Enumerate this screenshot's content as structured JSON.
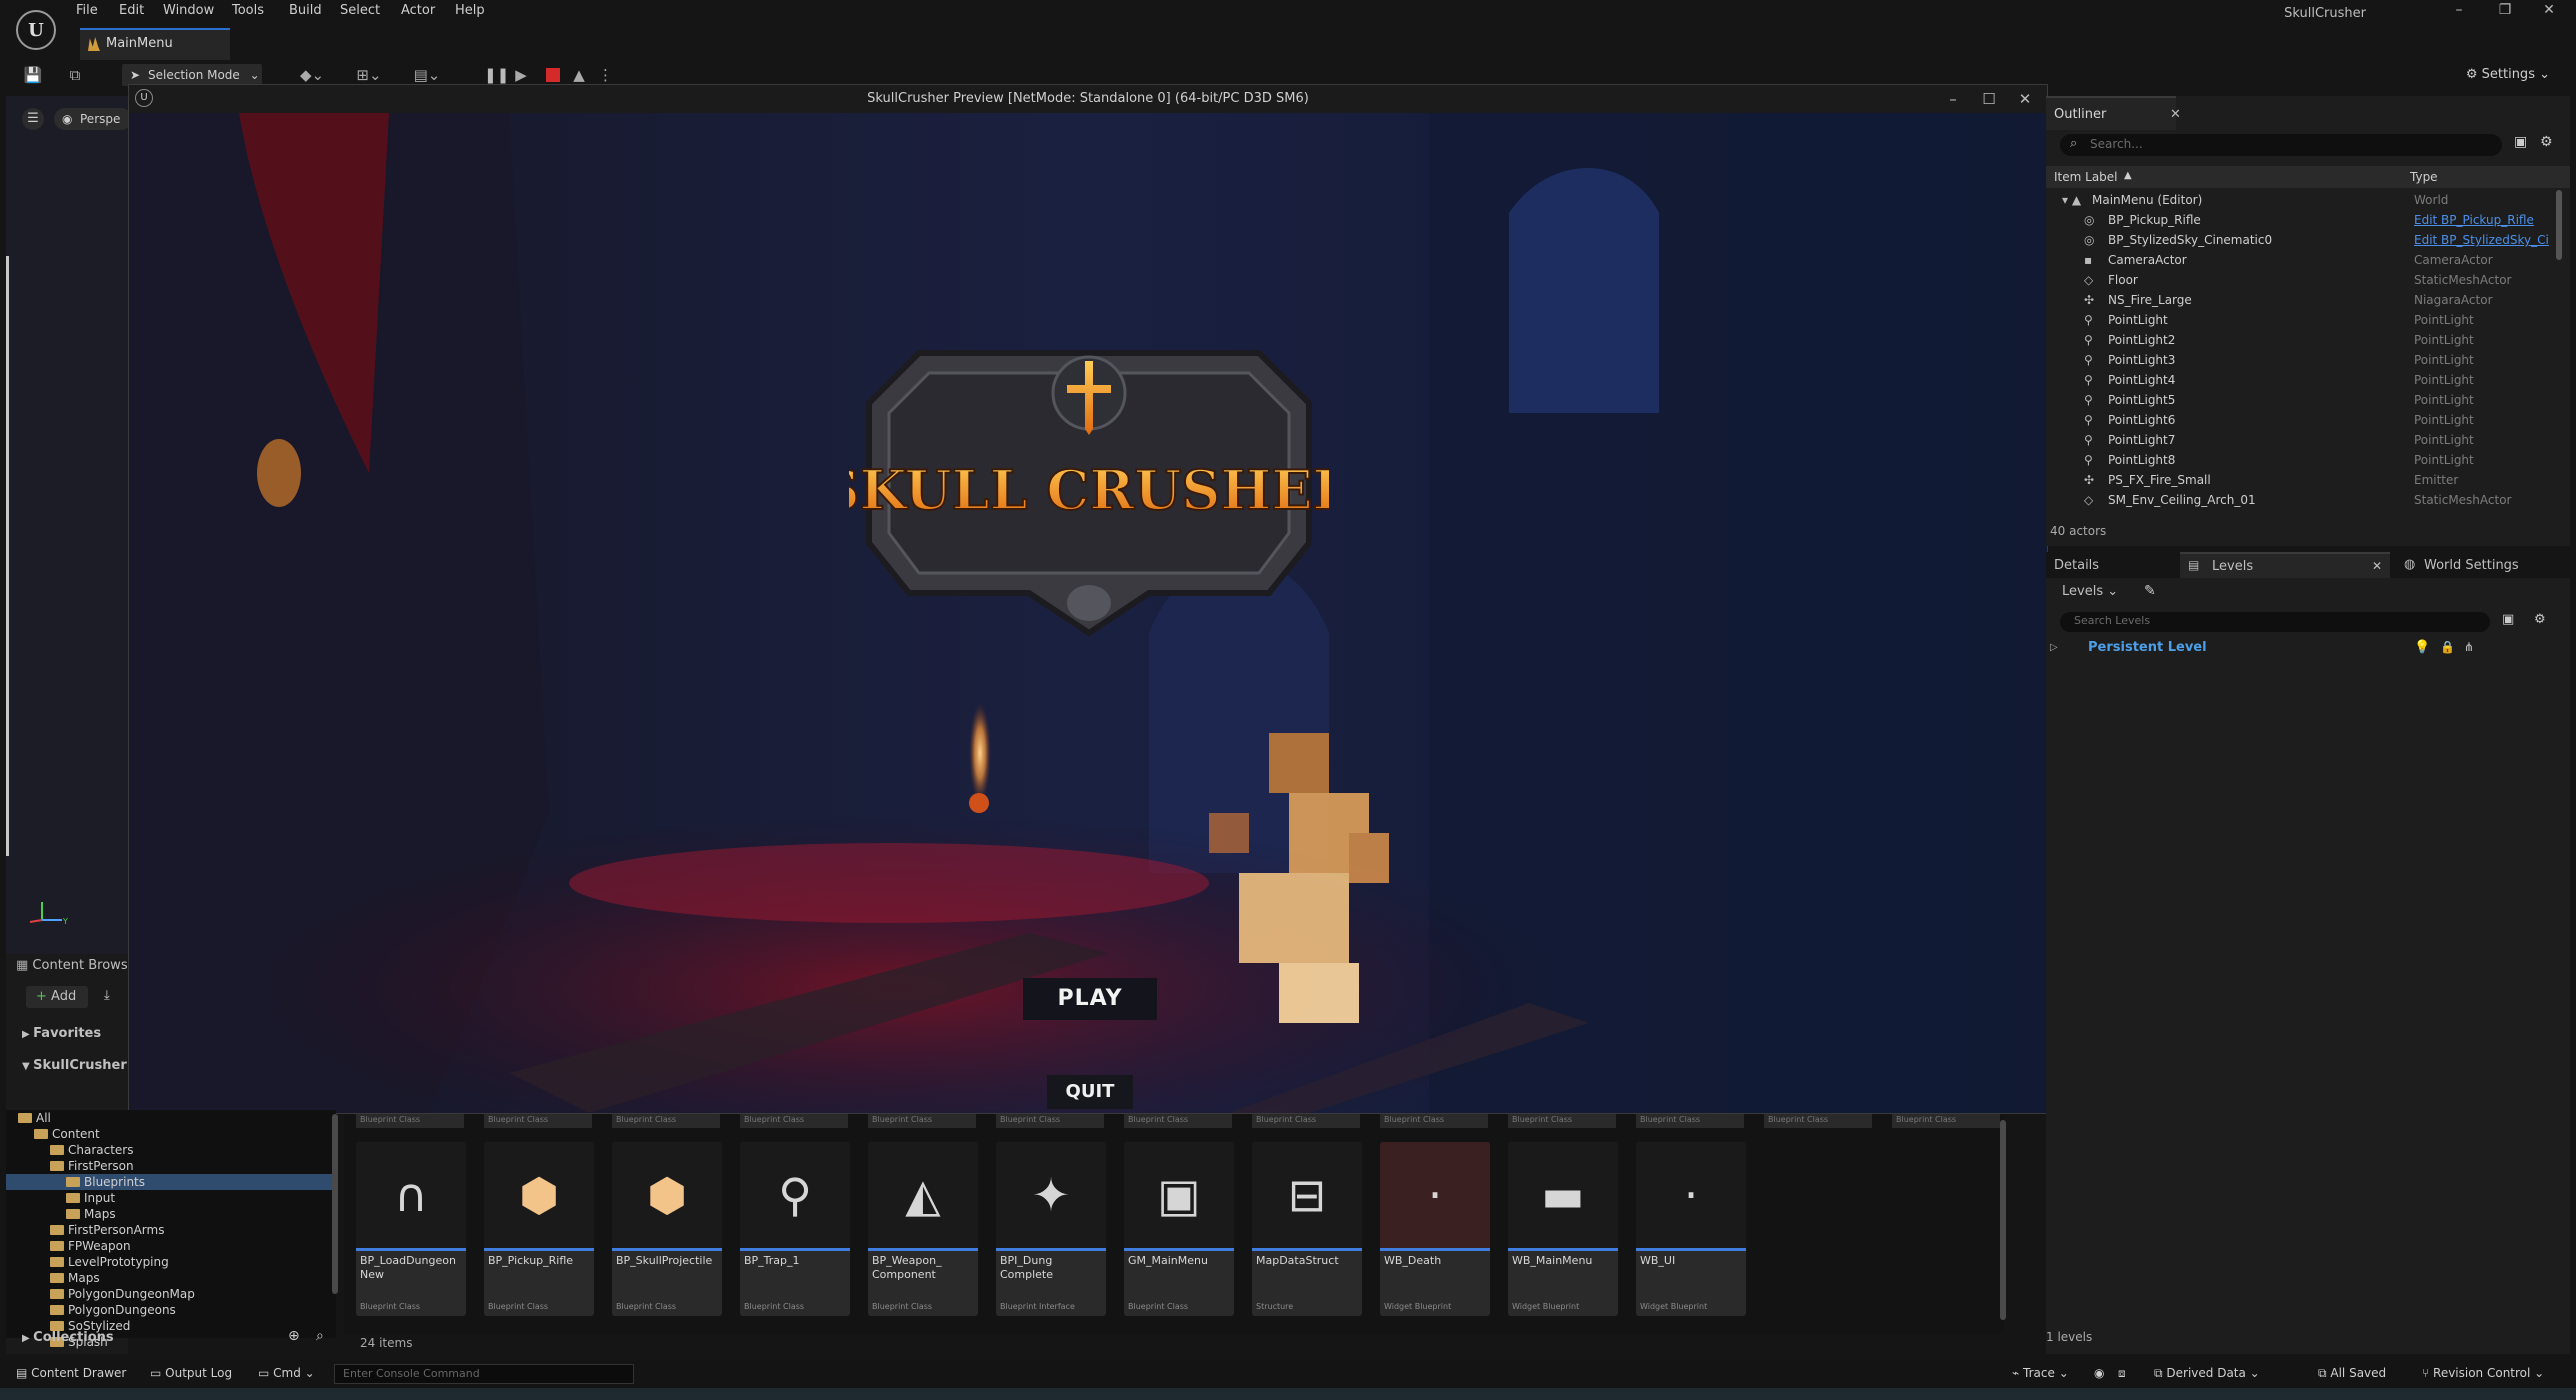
{
  "app": {
    "title": "SkullCrusher",
    "document_tab": "MainMenu",
    "logo_letter": "U"
  },
  "menu": [
    "File",
    "Edit",
    "Window",
    "Tools",
    "Build",
    "Select",
    "Actor",
    "Help"
  ],
  "toolbar": {
    "selection_mode": "Selection Mode",
    "settings": "Settings"
  },
  "viewport": {
    "perspective": "Perspe"
  },
  "preview": {
    "title": "SkullCrusher Preview [NetMode: Standalone 0]  (64-bit/PC D3D SM6)",
    "game_logo_text": "SKULL CRUSHER",
    "play": "PLAY",
    "quit": "QUIT"
  },
  "outliner": {
    "tab": "Outliner",
    "search_placeholder": "Search...",
    "col_label": "Item Label",
    "col_type": "Type",
    "rows": [
      {
        "label": "MainMenu (Editor)",
        "type": "World"
      },
      {
        "label": "BP_Pickup_Rifle",
        "type": "Edit BP_Pickup_Rifle"
      },
      {
        "label": "BP_StylizedSky_Cinematic0",
        "type": "Edit BP_StylizedSky_Ci"
      },
      {
        "label": "CameraActor",
        "type": "CameraActor"
      },
      {
        "label": "Floor",
        "type": "StaticMeshActor"
      },
      {
        "label": "NS_Fire_Large",
        "type": "NiagaraActor"
      },
      {
        "label": "PointLight",
        "type": "PointLight"
      },
      {
        "label": "PointLight2",
        "type": "PointLight"
      },
      {
        "label": "PointLight3",
        "type": "PointLight"
      },
      {
        "label": "PointLight4",
        "type": "PointLight"
      },
      {
        "label": "PointLight5",
        "type": "PointLight"
      },
      {
        "label": "PointLight6",
        "type": "PointLight"
      },
      {
        "label": "PointLight7",
        "type": "PointLight"
      },
      {
        "label": "PointLight8",
        "type": "PointLight"
      },
      {
        "label": "PS_FX_Fire_Small",
        "type": "Emitter"
      },
      {
        "label": "SM_Env_Ceiling_Arch_01",
        "type": "StaticMeshActor"
      }
    ],
    "actor_count": "40 actors"
  },
  "details": {
    "tab_details": "Details",
    "tab_levels": "Levels",
    "tab_world_settings": "World Settings",
    "levels_dropdown": "Levels",
    "search_placeholder": "Search Levels",
    "persistent_level": "Persistent Level",
    "levels_count": "1 levels"
  },
  "content_browser": {
    "tab": "Content Brows",
    "add": "Add",
    "favorites": "Favorites",
    "project": "SkullCrusher",
    "collections": "Collections",
    "tree": [
      {
        "label": "All",
        "indent": 0
      },
      {
        "label": "Content",
        "indent": 1
      },
      {
        "label": "Characters",
        "indent": 2
      },
      {
        "label": "FirstPerson",
        "indent": 2
      },
      {
        "label": "Blueprints",
        "indent": 3,
        "selected": true
      },
      {
        "label": "Input",
        "indent": 3
      },
      {
        "label": "Maps",
        "indent": 3
      },
      {
        "label": "FirstPersonArms",
        "indent": 2
      },
      {
        "label": "FPWeapon",
        "indent": 2
      },
      {
        "label": "LevelPrototyping",
        "indent": 2
      },
      {
        "label": "Maps",
        "indent": 2
      },
      {
        "label": "PolygonDungeonMap",
        "indent": 2
      },
      {
        "label": "PolygonDungeons",
        "indent": 2
      },
      {
        "label": "SoStylized",
        "indent": 2
      },
      {
        "label": "Splash",
        "indent": 2
      }
    ],
    "stub_label": "Blueprint Class",
    "assets": [
      {
        "name": "BP_LoadDungeon New",
        "kind": "Blueprint Class",
        "color": "#3d7ee0"
      },
      {
        "name": "BP_Pickup_Rifle",
        "kind": "Blueprint Class",
        "color": "#3d7ee0"
      },
      {
        "name": "BP_SkullProjectile",
        "kind": "Blueprint Class",
        "color": "#3d7ee0"
      },
      {
        "name": "BP_Trap_1",
        "kind": "Blueprint Class",
        "color": "#3d7ee0"
      },
      {
        "name": "BP_Weapon_ Component",
        "kind": "Blueprint Class",
        "color": "#3d7ee0"
      },
      {
        "name": "BPI_Dung Complete",
        "kind": "Blueprint Interface",
        "color": "#3d7ee0"
      },
      {
        "name": "GM_MainMenu",
        "kind": "Blueprint Class",
        "color": "#3d7ee0"
      },
      {
        "name": "MapDataStruct",
        "kind": "Structure",
        "color": "#3d7ee0"
      },
      {
        "name": "WB_Death",
        "kind": "Widget Blueprint",
        "color": "#3d7ee0"
      },
      {
        "name": "WB_MainMenu",
        "kind": "Widget Blueprint",
        "color": "#3d7ee0"
      },
      {
        "name": "WB_UI",
        "kind": "Widget Blueprint",
        "color": "#3d7ee0"
      }
    ],
    "item_count": "24 items"
  },
  "statusbar": {
    "content_drawer": "Content Drawer",
    "output_log": "Output Log",
    "cmd": "Cmd",
    "console_placeholder": "Enter Console Command",
    "trace": "Trace",
    "derived_data": "Derived Data",
    "all_saved": "All Saved",
    "revision_control": "Revision Control"
  }
}
